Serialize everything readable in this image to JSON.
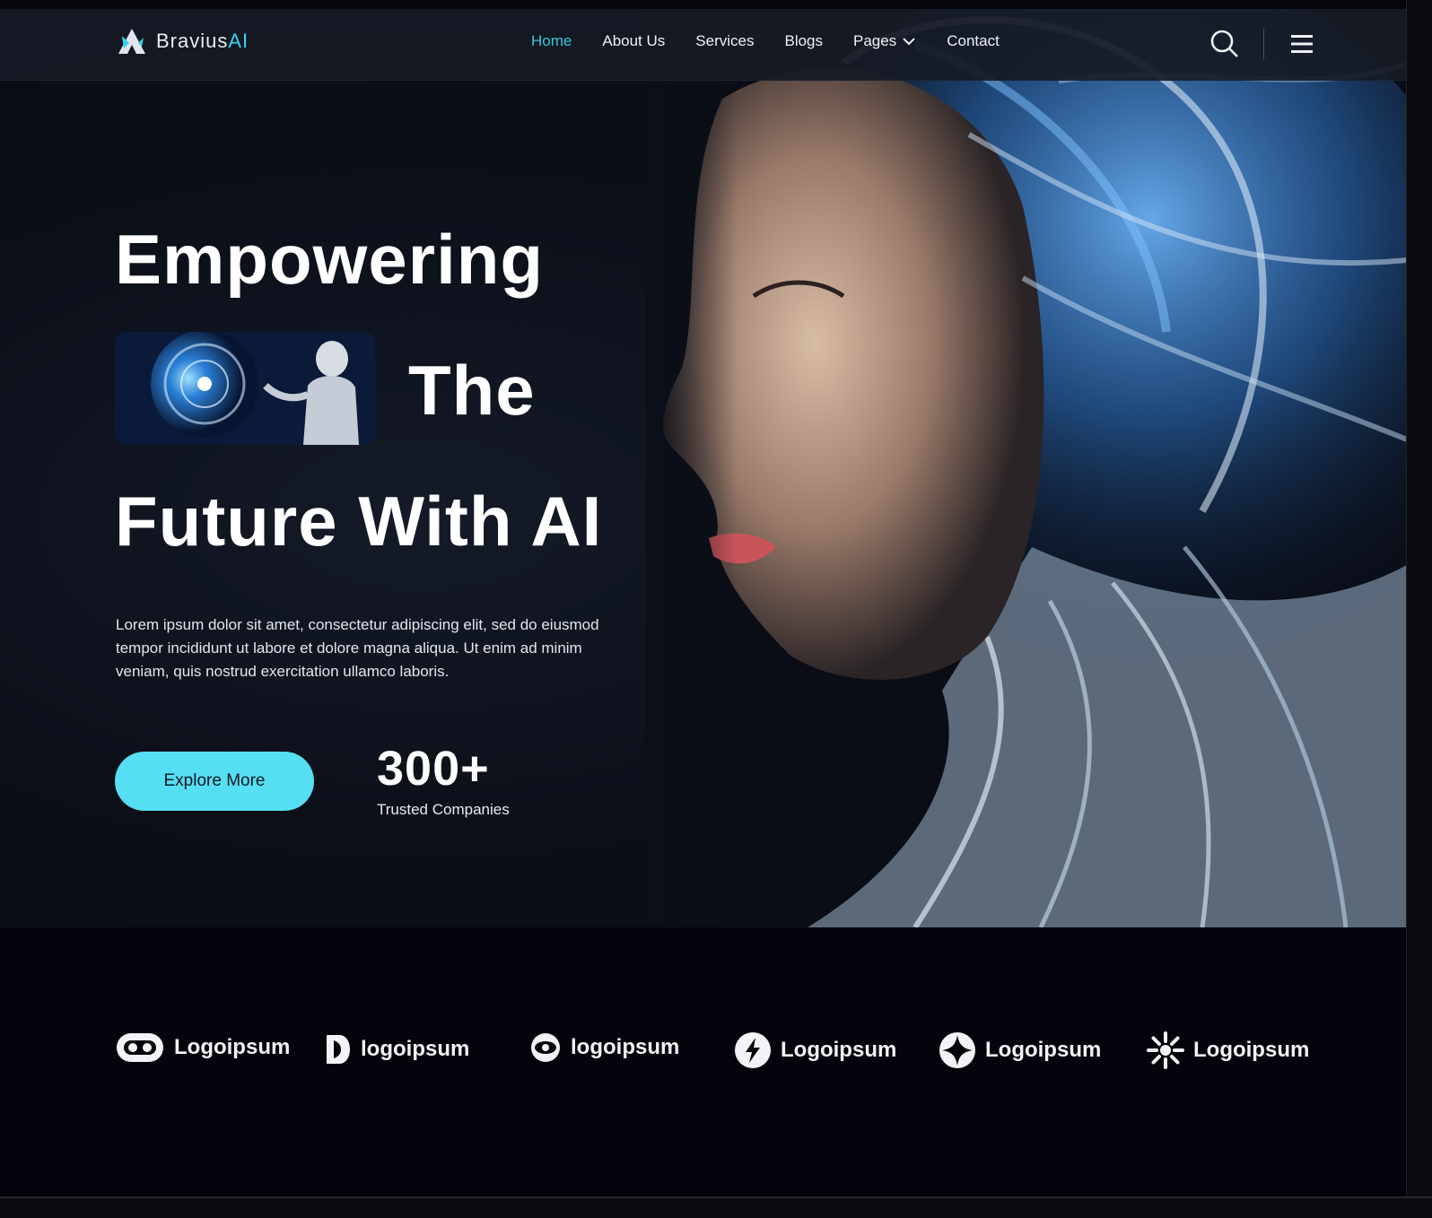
{
  "brand": {
    "name_main": "Bravius",
    "name_accent": "AI"
  },
  "nav": {
    "items": [
      {
        "label": "Home",
        "active": true
      },
      {
        "label": "About Us"
      },
      {
        "label": "Services"
      },
      {
        "label": "Blogs"
      },
      {
        "label": "Pages",
        "dropdown": true
      },
      {
        "label": "Contact"
      }
    ],
    "icons": [
      "search-icon",
      "menu-icon"
    ]
  },
  "hero": {
    "line1": "Empowering",
    "line2": "The",
    "line3": "Future With AI",
    "lead": "Lorem ipsum dolor sit amet, consectetur adipiscing elit, sed do eiusmod tempor incididunt ut labore et dolore magna aliqua. Ut enim ad minim veniam, quis nostrud exercitation ullamco laboris.",
    "cta": "Explore More",
    "stat_value": "300+",
    "stat_label": "Trusted Companies"
  },
  "logos": [
    "Logoipsum",
    "logoipsum",
    "logoipsum",
    "Logoipsum",
    "Logoipsum",
    "Logoipsum"
  ],
  "colors": {
    "accent": "#38d3ee",
    "button": "#56def2",
    "background": "#04060c",
    "nav_bg": "#161a24"
  }
}
